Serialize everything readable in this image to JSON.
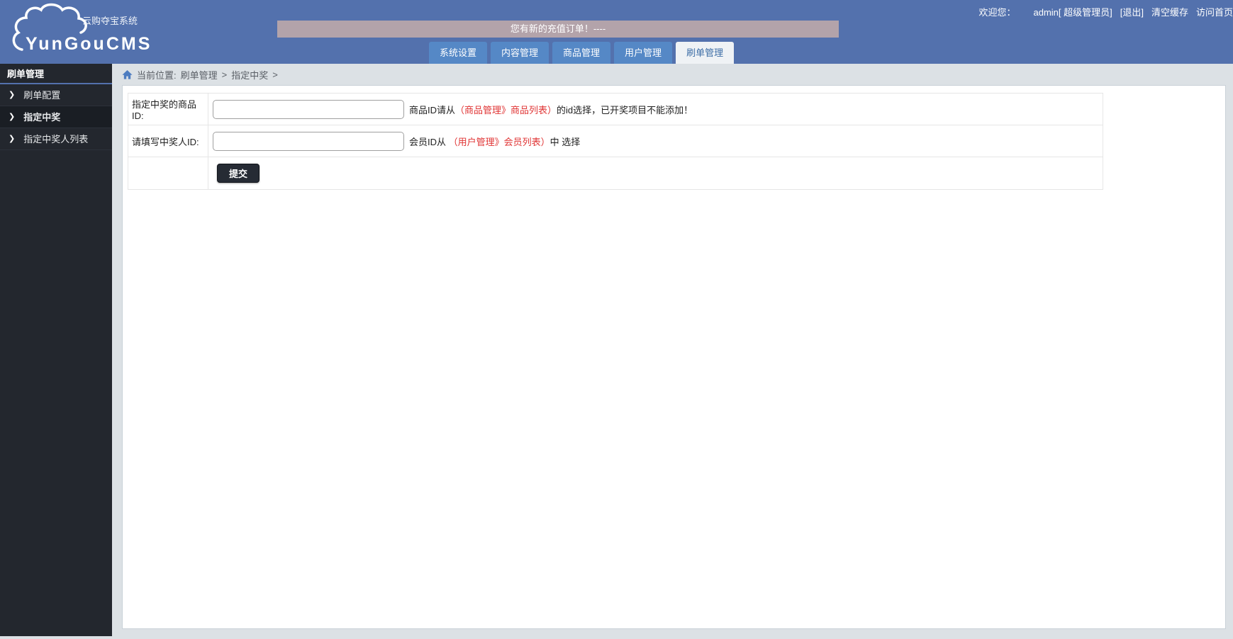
{
  "header": {
    "logo": {
      "brand": "YunGouCMS",
      "tagline": "云购夺宝系统"
    },
    "user_bar": {
      "welcome": "欢迎您：",
      "username": "admin[ 超级管理员]",
      "logout": "[退出]",
      "clear_cache": "清空缓存",
      "visit_home": "访问首页"
    },
    "notice": "您有新的充值订单！----",
    "tabs": [
      {
        "label": "系统设置",
        "active": false
      },
      {
        "label": "内容管理",
        "active": false
      },
      {
        "label": "商品管理",
        "active": false
      },
      {
        "label": "用户管理",
        "active": false
      },
      {
        "label": "刷单管理",
        "active": true
      }
    ]
  },
  "sidebar": {
    "title": "刷单管理",
    "items": [
      {
        "label": "刷单配置",
        "active": false
      },
      {
        "label": "指定中奖",
        "active": true
      },
      {
        "label": "指定中奖人列表",
        "active": false
      }
    ]
  },
  "breadcrumb": {
    "prefix": "当前位置:",
    "sep": ">",
    "items": [
      "刷单管理",
      "指定中奖"
    ]
  },
  "form": {
    "rows": [
      {
        "label": "指定中奖的商品ID:",
        "value": "",
        "hint_pre": "商品ID请从",
        "hint_highlight": "（商品管理》商品列表）",
        "hint_post": "的id选择，已开奖项目不能添加！"
      },
      {
        "label": "请填写中奖人ID:",
        "value": "",
        "hint_pre": "会员ID从 ",
        "hint_highlight": "（用户管理》会员列表）",
        "hint_post": "中 选择"
      }
    ],
    "submit_label": "提交"
  },
  "colors": {
    "header_bg": "#5371ad",
    "tab_bg": "#5588c6",
    "tab_active_bg": "#eff2f5",
    "tab_active_text": "#3c6da6",
    "notice_bg": "#b3a3aa",
    "sidebar_bg": "#23272e",
    "sidebar_active_bg": "#1a1e24",
    "highlight_red": "#e03434",
    "panel_bg": "#ffffff",
    "page_bg": "#dce1e5"
  }
}
